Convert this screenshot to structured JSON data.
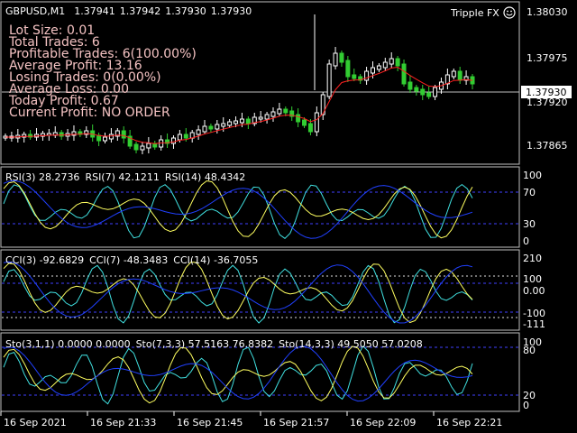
{
  "symbol_label": "GBPUSD,M1",
  "ohlc": [
    "1.37941",
    "1.37942",
    "1.37930",
    "1.37930"
  ],
  "expert_label": "Tripple FX",
  "current_price": "1.37930",
  "stats": [
    "Lot Size: 0.01",
    "Total Trades: 6",
    "Profitable Trades: 6(100.00%)",
    "Average Profit: 13.16",
    "Losing  Trades: 0(0.00%)",
    "Average Loss: 0.00",
    "Today Profit: 0.67",
    "Current Profit: NO ORDER"
  ],
  "price_axis": [
    "1.38030",
    "1.37975",
    "1.37920",
    "1.37865"
  ],
  "rsi_header": [
    "RSI(3) 28.2736",
    "RSI(7) 42.1211",
    "RSI(14) 48.4342"
  ],
  "rsi_axis": [
    "100",
    "70",
    "30",
    "0"
  ],
  "cci_header": [
    "CCI(3) -92.6829",
    "CCI(7) -48.3483",
    "CCI(14) -36.7055"
  ],
  "cci_axis": [
    "210",
    "100",
    "0.00",
    "-100",
    "-111"
  ],
  "sto_header": [
    "Sto(3,1,1) 0.0000 0.0000",
    "Sto(7,3,3) 57.5163 76.8382",
    "Sto(14,3,3) 49.5050 57.0208"
  ],
  "sto_axis": [
    "100",
    "80",
    "20",
    "0"
  ],
  "time_axis": [
    "16 Sep 2021",
    "16 Sep 21:33",
    "16 Sep 21:45",
    "16 Sep 21:57",
    "16 Sep 22:09",
    "16 Sep 22:21"
  ],
  "colors": {
    "bull": "#ffffff",
    "bear": "#32cd32",
    "ma": "#ff2020",
    "price_line": "#c0c0c0",
    "panel_border": "#c0c0c0",
    "level_line": "#4040ff",
    "ind_blue": "#2040ff",
    "ind_yellow": "#ffff60",
    "ind_cyan": "#40e0e0",
    "stats_text": "#f4c2c2"
  },
  "icons": {
    "expert_status": "smiley-icon"
  }
}
